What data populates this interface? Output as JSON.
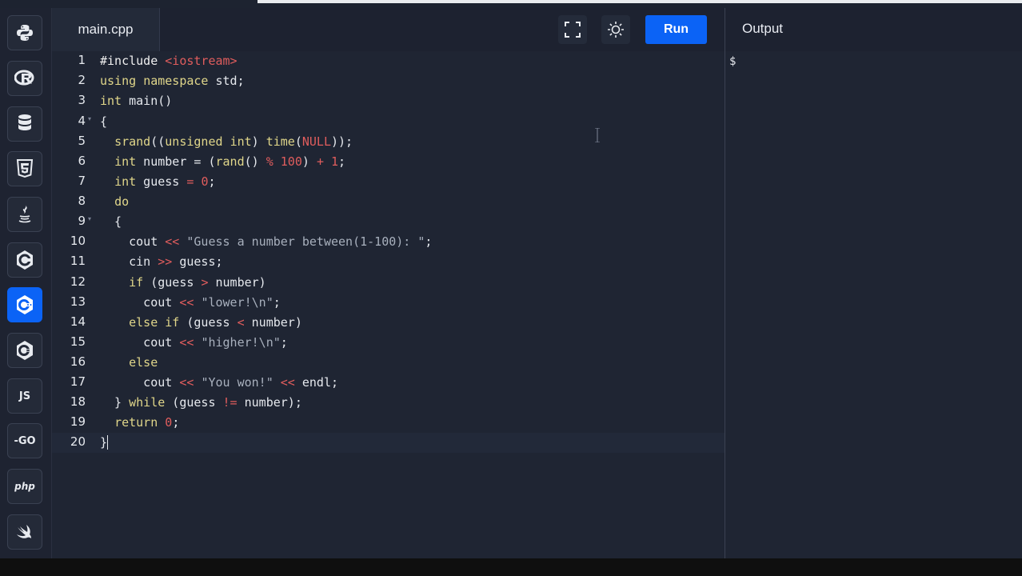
{
  "sidebar": {
    "languages": [
      {
        "name": "python-icon",
        "label": ""
      },
      {
        "name": "r-icon",
        "label": ""
      },
      {
        "name": "sql-icon",
        "label": ""
      },
      {
        "name": "html5-icon",
        "label": ""
      },
      {
        "name": "java-icon",
        "label": ""
      },
      {
        "name": "c-icon",
        "label": ""
      },
      {
        "name": "cpp-icon",
        "label": "",
        "active": true
      },
      {
        "name": "csharp-icon",
        "label": ""
      },
      {
        "name": "javascript-icon",
        "label": "JS"
      },
      {
        "name": "go-icon",
        "label": "-GO"
      },
      {
        "name": "php-icon",
        "label": "php"
      },
      {
        "name": "swift-icon",
        "label": ""
      }
    ]
  },
  "editor": {
    "tab_label": "main.cpp",
    "run_label": "Run",
    "fullscreen_icon": "fullscreen-icon",
    "theme_icon": "sun-icon",
    "lines": [
      "1",
      "2",
      "3",
      "4",
      "5",
      "6",
      "7",
      "8",
      "9",
      "10",
      "11",
      "12",
      "13",
      "14",
      "15",
      "16",
      "17",
      "18",
      "19",
      "20"
    ]
  },
  "output": {
    "title": "Output",
    "prompt": "$"
  },
  "colors": {
    "accent": "#0b63f6",
    "editor_bg": "#1f2533",
    "sidebar_bg": "#1e2331"
  }
}
